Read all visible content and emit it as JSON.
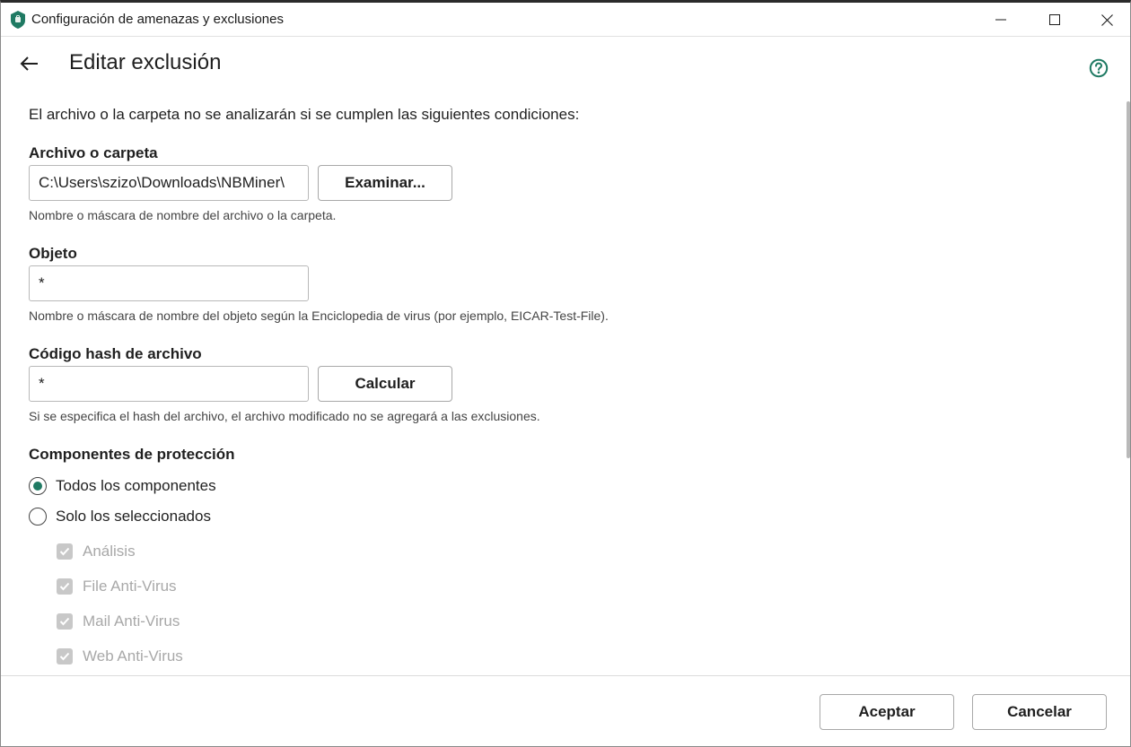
{
  "window": {
    "title": "Configuración de amenazas y exclusiones"
  },
  "header": {
    "title": "Editar exclusión"
  },
  "intro": "El archivo o la carpeta no se analizarán si se cumplen las siguientes condiciones:",
  "file": {
    "label": "Archivo o carpeta",
    "value": "C:\\Users\\szizo\\Downloads\\NBMiner\\",
    "browse_label": "Examinar...",
    "hint": "Nombre o máscara de nombre del archivo o la carpeta."
  },
  "object": {
    "label": "Objeto",
    "value": "*",
    "hint": "Nombre o máscara de nombre del objeto según la Enciclopedia de virus (por ejemplo, EICAR-Test-File)."
  },
  "hash": {
    "label": "Código hash de archivo",
    "value": "*",
    "calc_label": "Calcular",
    "hint": "Si se especifica el hash del archivo, el archivo modificado no se agregará a las exclusiones."
  },
  "components": {
    "label": "Componentes de protección",
    "options": [
      {
        "label": "Todos los componentes",
        "selected": true
      },
      {
        "label": "Solo los seleccionados",
        "selected": false
      }
    ],
    "items": [
      {
        "label": "Análisis",
        "checked": true,
        "disabled": true
      },
      {
        "label": "File Anti-Virus",
        "checked": true,
        "disabled": true
      },
      {
        "label": "Mail Anti-Virus",
        "checked": true,
        "disabled": true
      },
      {
        "label": "Web Anti-Virus",
        "checked": true,
        "disabled": true
      }
    ]
  },
  "footer": {
    "ok_label": "Aceptar",
    "cancel_label": "Cancelar"
  },
  "colors": {
    "accent": "#1f7a63",
    "disabled_text": "#a8a8a8"
  }
}
